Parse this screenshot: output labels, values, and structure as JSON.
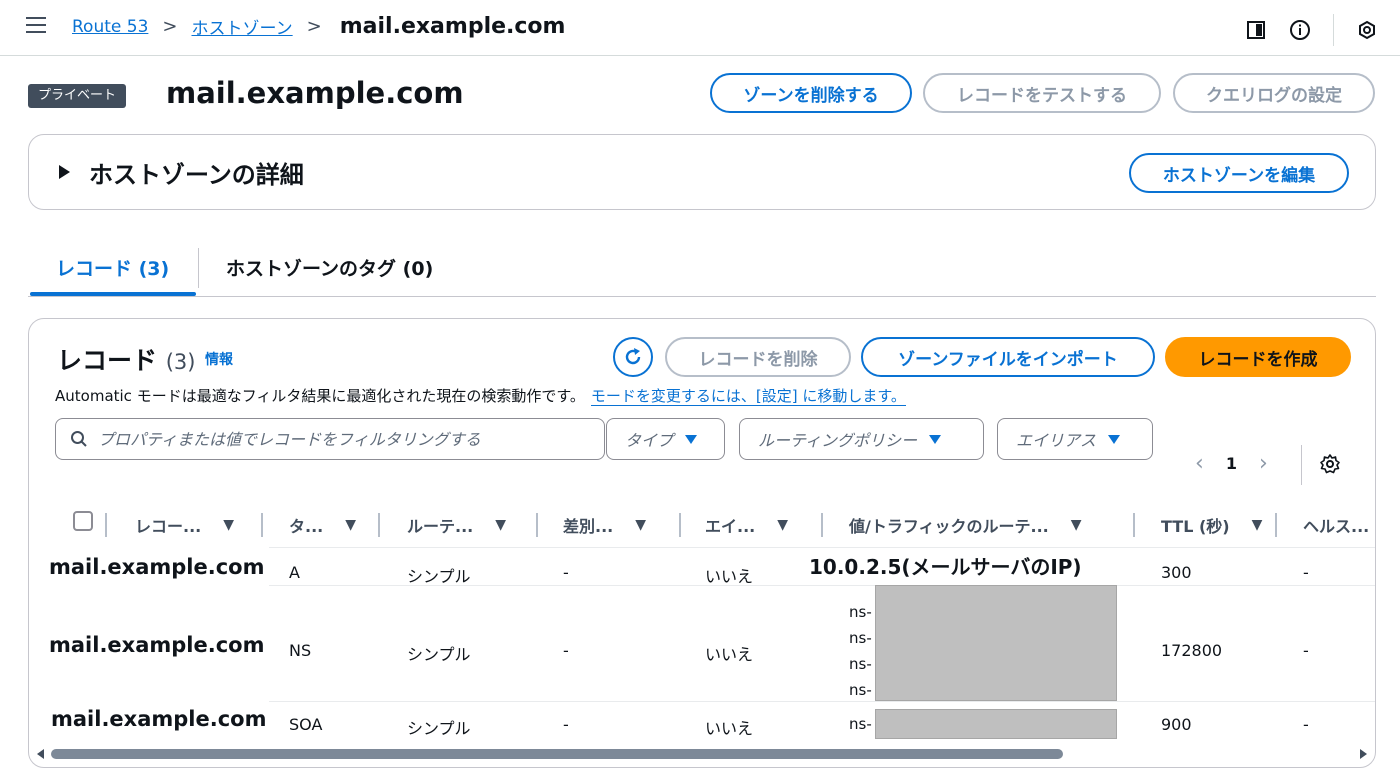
{
  "breadcrumb": {
    "items": [
      "Route 53",
      "ホストゾーン"
    ],
    "current": "mail.example.com"
  },
  "header": {
    "badge": "プライベート",
    "title": "mail.example.com",
    "delete_zone": "ゾーンを削除する",
    "test_record": "レコードをテストする",
    "query_log": "クエリログの設定"
  },
  "details": {
    "title": "ホストゾーンの詳細",
    "edit": "ホストゾーンを編集"
  },
  "tabs": [
    {
      "label": "レコード (3)",
      "active": true
    },
    {
      "label": "ホストゾーンのタグ (0)",
      "active": false
    }
  ],
  "records_panel": {
    "title": "レコード",
    "count": "(3)",
    "info": "情報",
    "delete_btn": "レコードを削除",
    "import_btn": "ゾーンファイルをインポート",
    "create_btn": "レコードを作成",
    "desc": "Automatic モードは最適なフィルタ結果に最適化された現在の検索動作です。",
    "desc_link": "モードを変更するには、[設定] に移動します。",
    "search_placeholder": "プロパティまたは値でレコードをフィルタリングする",
    "filters": [
      "タイプ",
      "ルーティングポリシー",
      "エイリアス"
    ],
    "page": "1"
  },
  "table": {
    "columns": [
      "レコー...",
      "タ...",
      "ルーテ...",
      "差別...",
      "エイ...",
      "値/トラフィックのルーテ...",
      "TTL (秒)",
      "ヘルス..."
    ],
    "rows": [
      {
        "name": "mail.example.com",
        "type": "A",
        "routing": "シンプル",
        "diff": "-",
        "alias": "いいえ",
        "value": "10.0.2.5(メールサーバのIP)",
        "ttl": "300",
        "health": "-"
      },
      {
        "name": "mail.example.com",
        "type": "NS",
        "routing": "シンプル",
        "diff": "-",
        "alias": "いいえ",
        "value_lines": [
          "ns-",
          "ns-",
          "ns-",
          "ns-"
        ],
        "ttl": "172800",
        "health": "-"
      },
      {
        "name": "mail.example.com",
        "type": "SOA",
        "routing": "シンプル",
        "diff": "-",
        "alias": "いいえ",
        "value_lines": [
          "ns-"
        ],
        "ttl": "900",
        "health": "-"
      }
    ]
  },
  "colors": {
    "accent": "#0972d3",
    "primary_button": "#ff9900",
    "badge_bg": "#414d5c",
    "redaction": "#bfbfbf"
  },
  "icons": [
    "menu-icon",
    "panel-icon",
    "info-icon",
    "notifications-icon",
    "refresh-icon",
    "search-icon",
    "gear-icon"
  ]
}
